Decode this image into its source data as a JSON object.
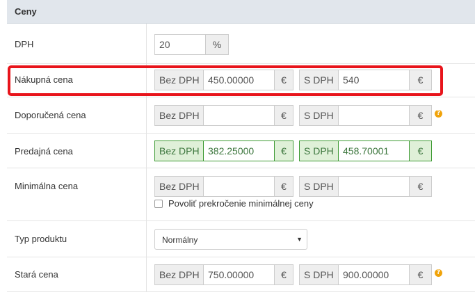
{
  "panel": {
    "title": "Ceny"
  },
  "vat": {
    "label": "DPH",
    "value": "20",
    "unit": "%"
  },
  "purchase_price": {
    "label": "Nákupná cena",
    "without_vat_label": "Bez DPH",
    "without_vat_value": "450.00000",
    "with_vat_label": "S DPH",
    "with_vat_value": "540",
    "currency": "€"
  },
  "recommended_price": {
    "label": "Doporučená cena",
    "without_vat_label": "Bez DPH",
    "without_vat_value": "",
    "with_vat_label": "S DPH",
    "with_vat_value": "",
    "currency": "€",
    "help": "?"
  },
  "selling_price": {
    "label": "Predajná cena",
    "without_vat_label": "Bez DPH",
    "without_vat_value": "382.25000",
    "with_vat_label": "S DPH",
    "with_vat_value": "458.70001",
    "currency": "€"
  },
  "minimal_price": {
    "label": "Minimálna cena",
    "without_vat_label": "Bez DPH",
    "without_vat_value": "",
    "with_vat_label": "S DPH",
    "with_vat_value": "",
    "currency": "€",
    "allow_exceed_label": "Povoliť prekročenie minimálnej ceny",
    "allow_exceed_checked": false
  },
  "product_type": {
    "label": "Typ produktu",
    "selected": "Normálny"
  },
  "old_price": {
    "label": "Stará cena",
    "without_vat_label": "Bez DPH",
    "without_vat_value": "750.00000",
    "with_vat_label": "S DPH",
    "with_vat_value": "900.00000",
    "currency": "€",
    "help": "?"
  },
  "colors": {
    "header_bg": "#e1e6ec",
    "highlight": "#e8141b",
    "success": "#3c9a32",
    "help": "#f0a30a"
  }
}
